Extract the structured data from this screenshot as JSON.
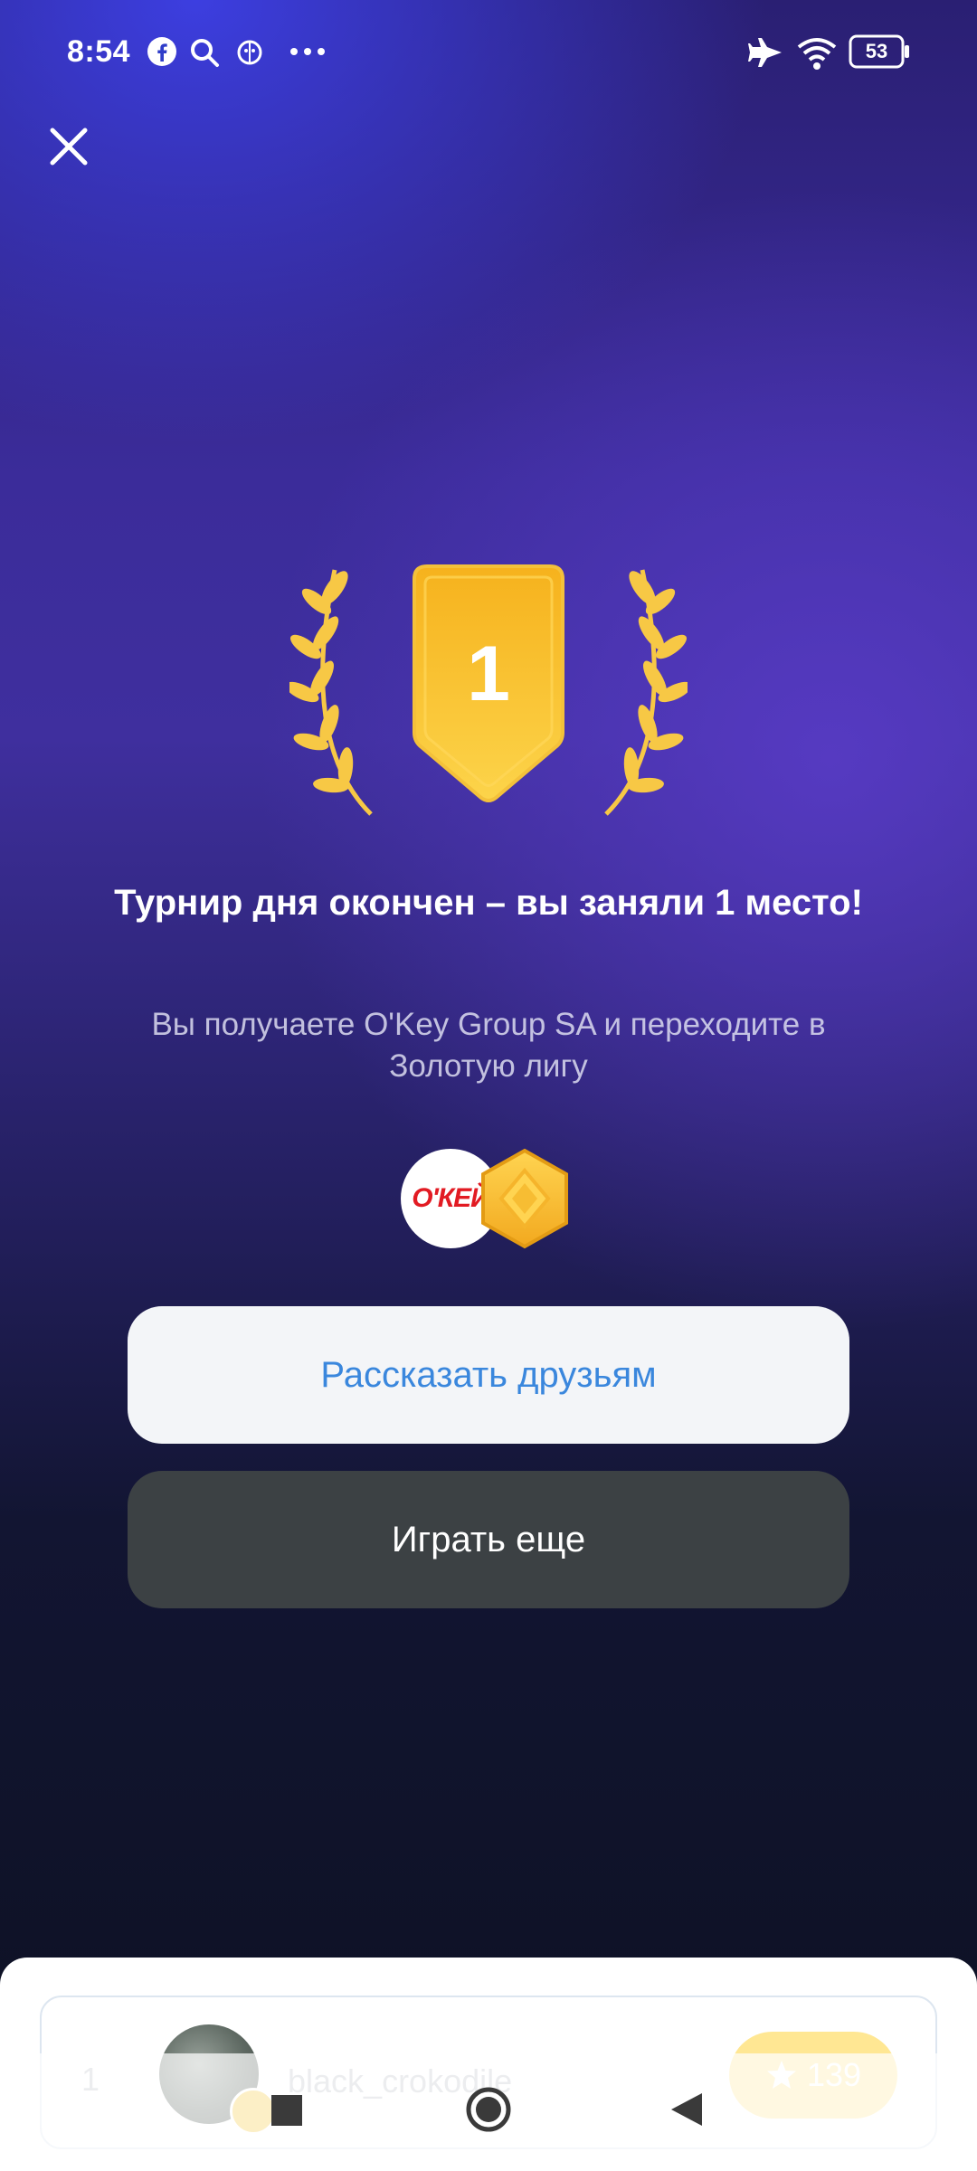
{
  "status_bar": {
    "time": "8:54",
    "battery": "53",
    "icons": [
      "facebook-icon",
      "search-icon",
      "bug-icon",
      "more-dots-icon",
      "airplane-icon",
      "wifi-icon",
      "battery-icon"
    ]
  },
  "header": {
    "close_icon": "close-icon"
  },
  "result": {
    "place": "1",
    "title": "Турнир дня окончен – вы заняли 1 место!",
    "subtitle": "Вы получаете O'Key Group SA и переходите в Золотую лигу",
    "reward_logo": "О'КЕЙ"
  },
  "buttons": {
    "share": "Рассказать друзьям",
    "play_again": "Играть еще"
  },
  "leaderboard": {
    "rank": "1",
    "username": "black_crokodile",
    "score": "139"
  },
  "colors": {
    "accent_blue": "#3a87dd",
    "gold": "#f8bd2a",
    "okey_red": "#e21b23"
  }
}
